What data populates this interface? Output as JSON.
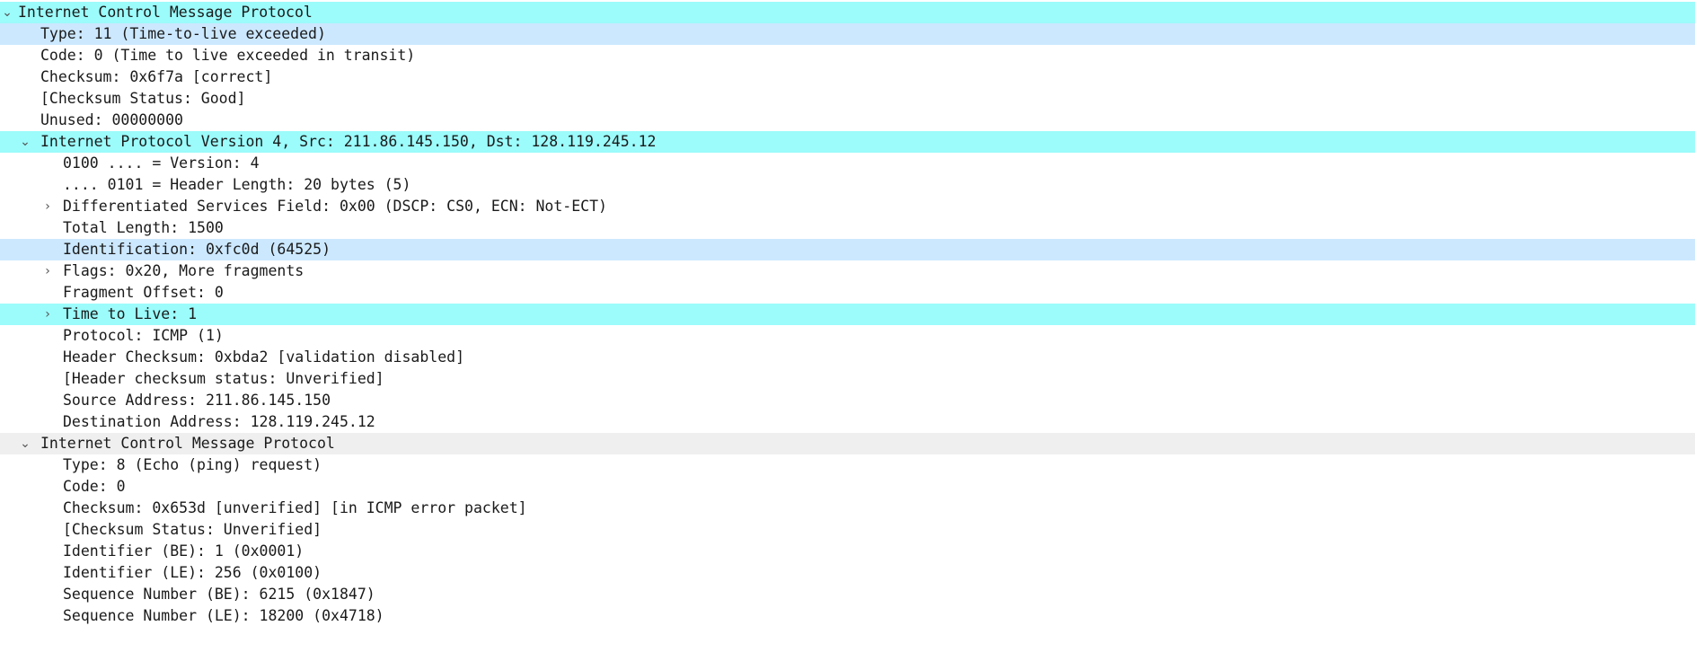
{
  "colors": {
    "selected_row": "#9cfbfb",
    "related_row": "#cce8ff",
    "hover_row": "#efefef"
  },
  "icons": {
    "expanded": "⌄",
    "collapsed": "›"
  },
  "rows": {
    "icmp": "Internet Control Message Protocol",
    "icmp_type": "Type: 11 (Time-to-live exceeded)",
    "icmp_code": "Code: 0 (Time to live exceeded in transit)",
    "icmp_checksum": "Checksum: 0x6f7a [correct]",
    "icmp_checksum_status": "[Checksum Status: Good]",
    "icmp_unused": "Unused: 00000000",
    "ipv4": "Internet Protocol Version 4, Src: 211.86.145.150, Dst: 128.119.245.12",
    "ip_version": "0100 .... = Version: 4",
    "ip_header_length": ".... 0101 = Header Length: 20 bytes (5)",
    "ip_dsfield": "Differentiated Services Field: 0x00 (DSCP: CS0, ECN: Not-ECT)",
    "ip_total_length": "Total Length: 1500",
    "ip_identification": "Identification: 0xfc0d (64525)",
    "ip_flags": "Flags: 0x20, More fragments",
    "ip_fragment_offset": "Fragment Offset: 0",
    "ip_ttl": "Time to Live: 1",
    "ip_protocol": "Protocol: ICMP (1)",
    "ip_header_checksum": "Header Checksum: 0xbda2 [validation disabled]",
    "ip_header_checksum_status": "[Header checksum status: Unverified]",
    "ip_source": "Source Address: 211.86.145.150",
    "ip_destination": "Destination Address: 128.119.245.12",
    "inner_icmp": "Internet Control Message Protocol",
    "inner_type": "Type: 8 (Echo (ping) request)",
    "inner_code": "Code: 0",
    "inner_checksum": "Checksum: 0x653d [unverified] [in ICMP error packet]",
    "inner_checksum_status": "[Checksum Status: Unverified]",
    "inner_identifier_be": "Identifier (BE): 1 (0x0001)",
    "inner_identifier_le": "Identifier (LE): 256 (0x0100)",
    "inner_seq_be": "Sequence Number (BE): 6215 (0x1847)",
    "inner_seq_le": "Sequence Number (LE): 18200 (0x4718)"
  }
}
